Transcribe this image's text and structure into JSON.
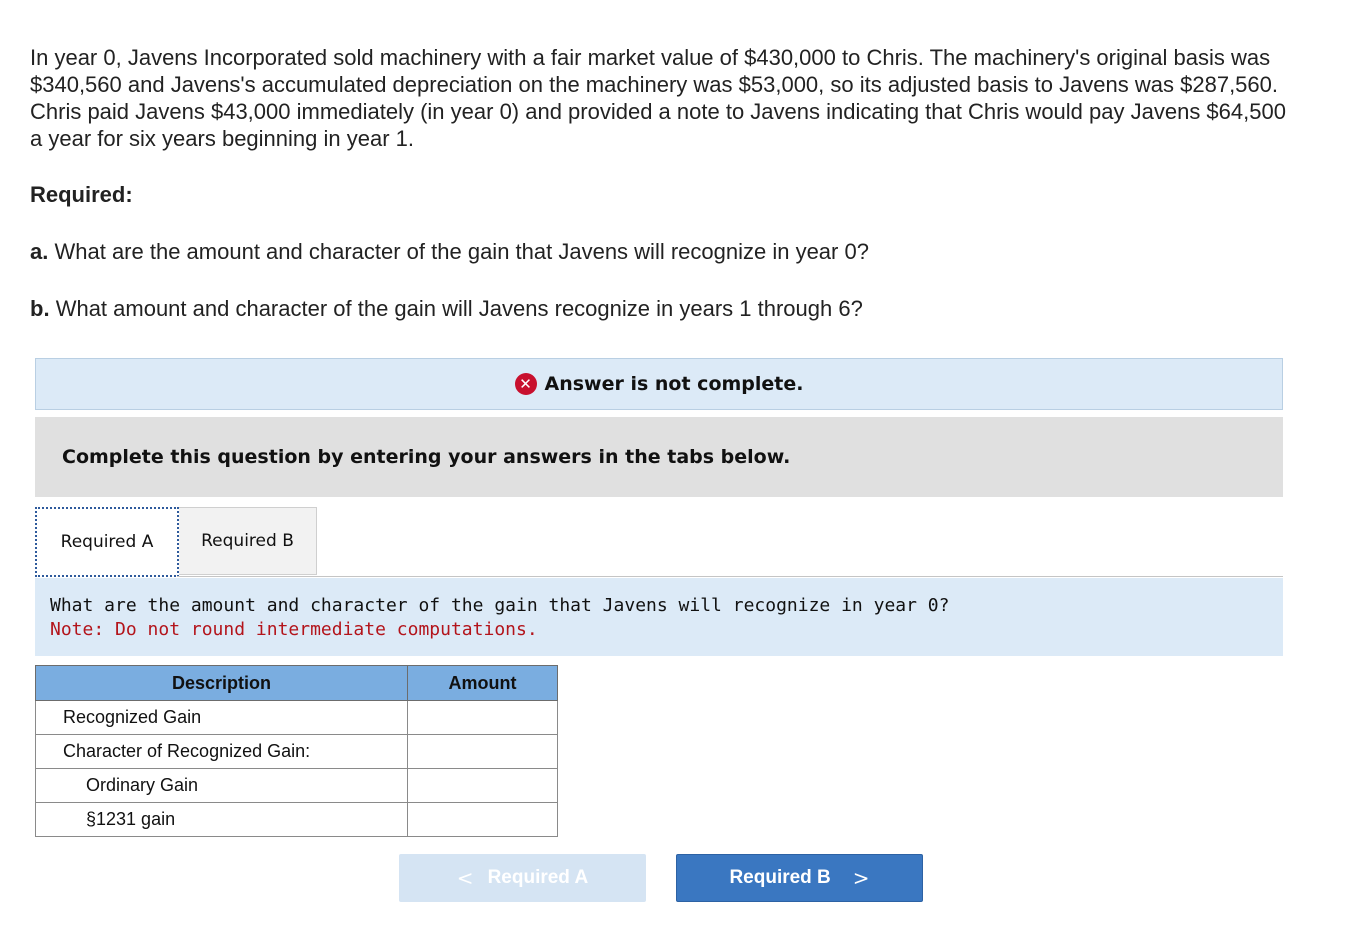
{
  "problem": {
    "text": "In year 0, Javens Incorporated sold machinery with a fair market value of $430,000 to Chris. The machinery's original basis was $340,560 and Javens's accumulated depreciation on the machinery was $53,000, so its adjusted basis to Javens was $287,560. Chris paid Javens $43,000 immediately (in year 0) and provided a note to Javens indicating that Chris would pay Javens $64,500 a year for six years beginning in year 1."
  },
  "required": {
    "heading": "Required:",
    "a_label": "a.",
    "a_text": "What are the amount and character of the gain that Javens will recognize in year 0?",
    "b_label": "b.",
    "b_text": "What amount and character of the gain will Javens recognize in years 1 through 6?"
  },
  "status": {
    "icon": "x-icon",
    "text": "Answer is not complete."
  },
  "instruction": "Complete this question by entering your answers in the tabs below.",
  "tabs": [
    {
      "label": "Required A",
      "active": true
    },
    {
      "label": "Required B",
      "active": false
    }
  ],
  "prompt": {
    "question": "What are the amount and character of the gain that Javens will recognize in year 0?",
    "note": "Note: Do not round intermediate computations."
  },
  "table": {
    "headers": [
      "Description",
      "Amount"
    ],
    "rows": [
      {
        "description": "Recognized Gain",
        "amount": ""
      },
      {
        "description": "Character of Recognized Gain:",
        "amount": ""
      },
      {
        "description": "Ordinary Gain",
        "amount": ""
      },
      {
        "description": "§1231 gain",
        "amount": ""
      }
    ]
  },
  "nav": {
    "prev_label": "Required A",
    "next_label": "Required B",
    "prev_icon": "chevron-left-icon",
    "next_icon": "chevron-right-icon"
  },
  "colors": {
    "header_blue": "#7aade0",
    "error_red": "#c8102e",
    "note_red": "#b3141b",
    "next_button": "#3a77c1"
  }
}
